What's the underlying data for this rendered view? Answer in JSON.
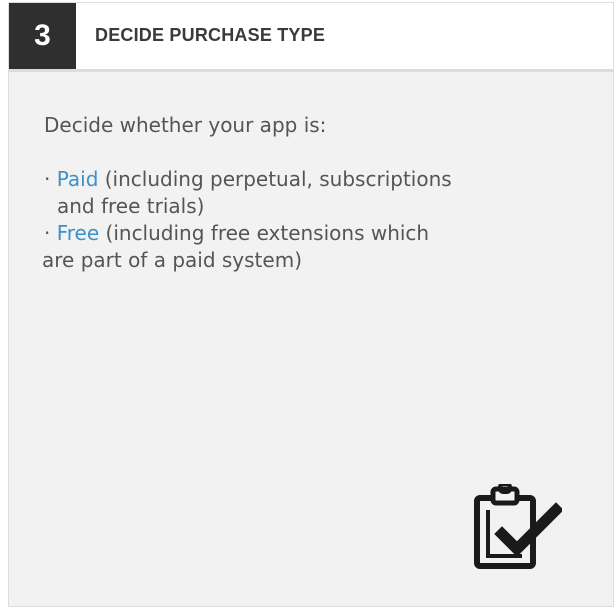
{
  "step": {
    "number": "3",
    "title": "DECIDE PURCHASE TYPE"
  },
  "content": {
    "intro": "Decide whether your app is:",
    "bullets": [
      {
        "marker": "· ",
        "highlight": "Paid",
        "rest_line1": " (including perpetual, subscriptions",
        "rest_line2": "and free trials)"
      },
      {
        "marker": "· ",
        "highlight": "Free",
        "rest_line1": " (including free extensions which",
        "rest_line2": "are part of a paid system)"
      }
    ]
  },
  "icon": "clipboard-check-icon",
  "colors": {
    "badge_bg": "#2f2f2f",
    "link": "#3f8fc9",
    "card_bg": "#f2f2f2",
    "text": "#555555"
  }
}
